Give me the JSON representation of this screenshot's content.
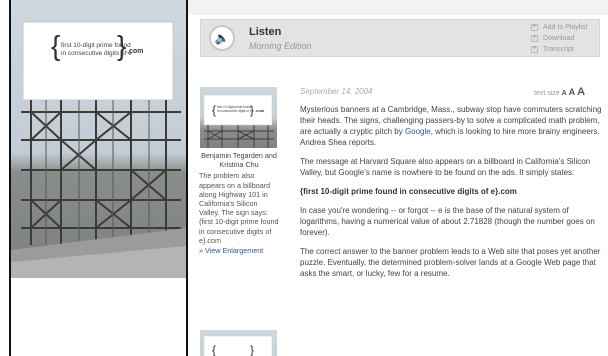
{
  "photo": {
    "billboard_text_line1": "first 10-digit prime found",
    "billboard_text_line2": "in consecutive digits of e",
    "billboard_suffix": ".com"
  },
  "listen": {
    "title": "Listen",
    "program": "Morning Edition",
    "actions": [
      "Add to Playlist",
      "Download",
      "Transcript"
    ]
  },
  "story": {
    "date": "September 14, 2004",
    "text_size_label": "text size",
    "text_size_options": [
      "A",
      "A",
      "A"
    ],
    "thumbnail": {
      "billboard_text_line1": "first 10-digit prime found",
      "billboard_text_line2": "in consecutive digits of e",
      "billboard_suffix": ".com"
    },
    "photo_credit": "Benjamin Tegarden and Kristina Chu",
    "caption": "The problem also appears on a billboard along Highway 101 in California's Silicon Valley. The sign says: {first 10-digit prime found in consecutive digits of e}.com",
    "enlarge_link": "» View Enlargement",
    "p1_before_link": "Mysterious banners at a Cambridge, Mass., subway stop have commuters scratching their heads. The signs, challenging passers-by to solve a complicated math problem, are actually a cryptic pitch by ",
    "p1_link": "Google",
    "p1_after_link": ", which is looking to hire more brainy engineers. Andrea Shea reports.",
    "p2": "The message at Harvard Square also appears on a billboard in California's Silicon Valley, but Google's name is nowhere to be found on the ads. It simply states:",
    "p3_bold": "{first 10-digit prime found in consecutive digits of e}.com",
    "p4": "In case you're wondering -- or forgot -- e is the base of the natural system of logarithms, having a numerical value of about 2.71828 (though the number goes on forever).",
    "p5": "The correct answer to the banner problem leads to a Web site that poses yet another puzzle. Eventually, the determined problem-solver lands at a Google Web page that asks the smart, or lucky, few for a resume."
  }
}
